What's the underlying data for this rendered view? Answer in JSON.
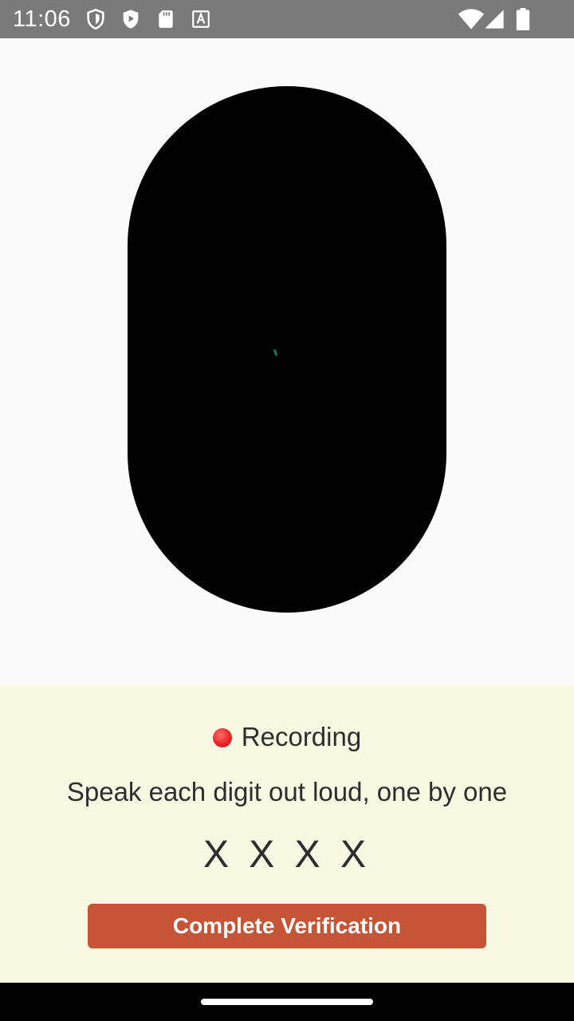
{
  "status_bar": {
    "time": "11:06",
    "left_icons": [
      "shield-icon",
      "play-protect-icon",
      "sd-card-icon",
      "font-a-icon"
    ],
    "right_icons": [
      "wifi-icon",
      "signal-icon",
      "battery-icon"
    ]
  },
  "camera": {
    "shape": "oval",
    "background": "#000000"
  },
  "recording": {
    "label": "Recording",
    "dot_color": "#e8262b"
  },
  "instruction": "Speak each digit out loud, one by one",
  "digits": "X X X X",
  "actions": {
    "complete_label": "Complete Verification",
    "accent": "#c55536"
  },
  "colors": {
    "status_bar": "#7a7a7a",
    "panel": "#f7f9e2"
  }
}
